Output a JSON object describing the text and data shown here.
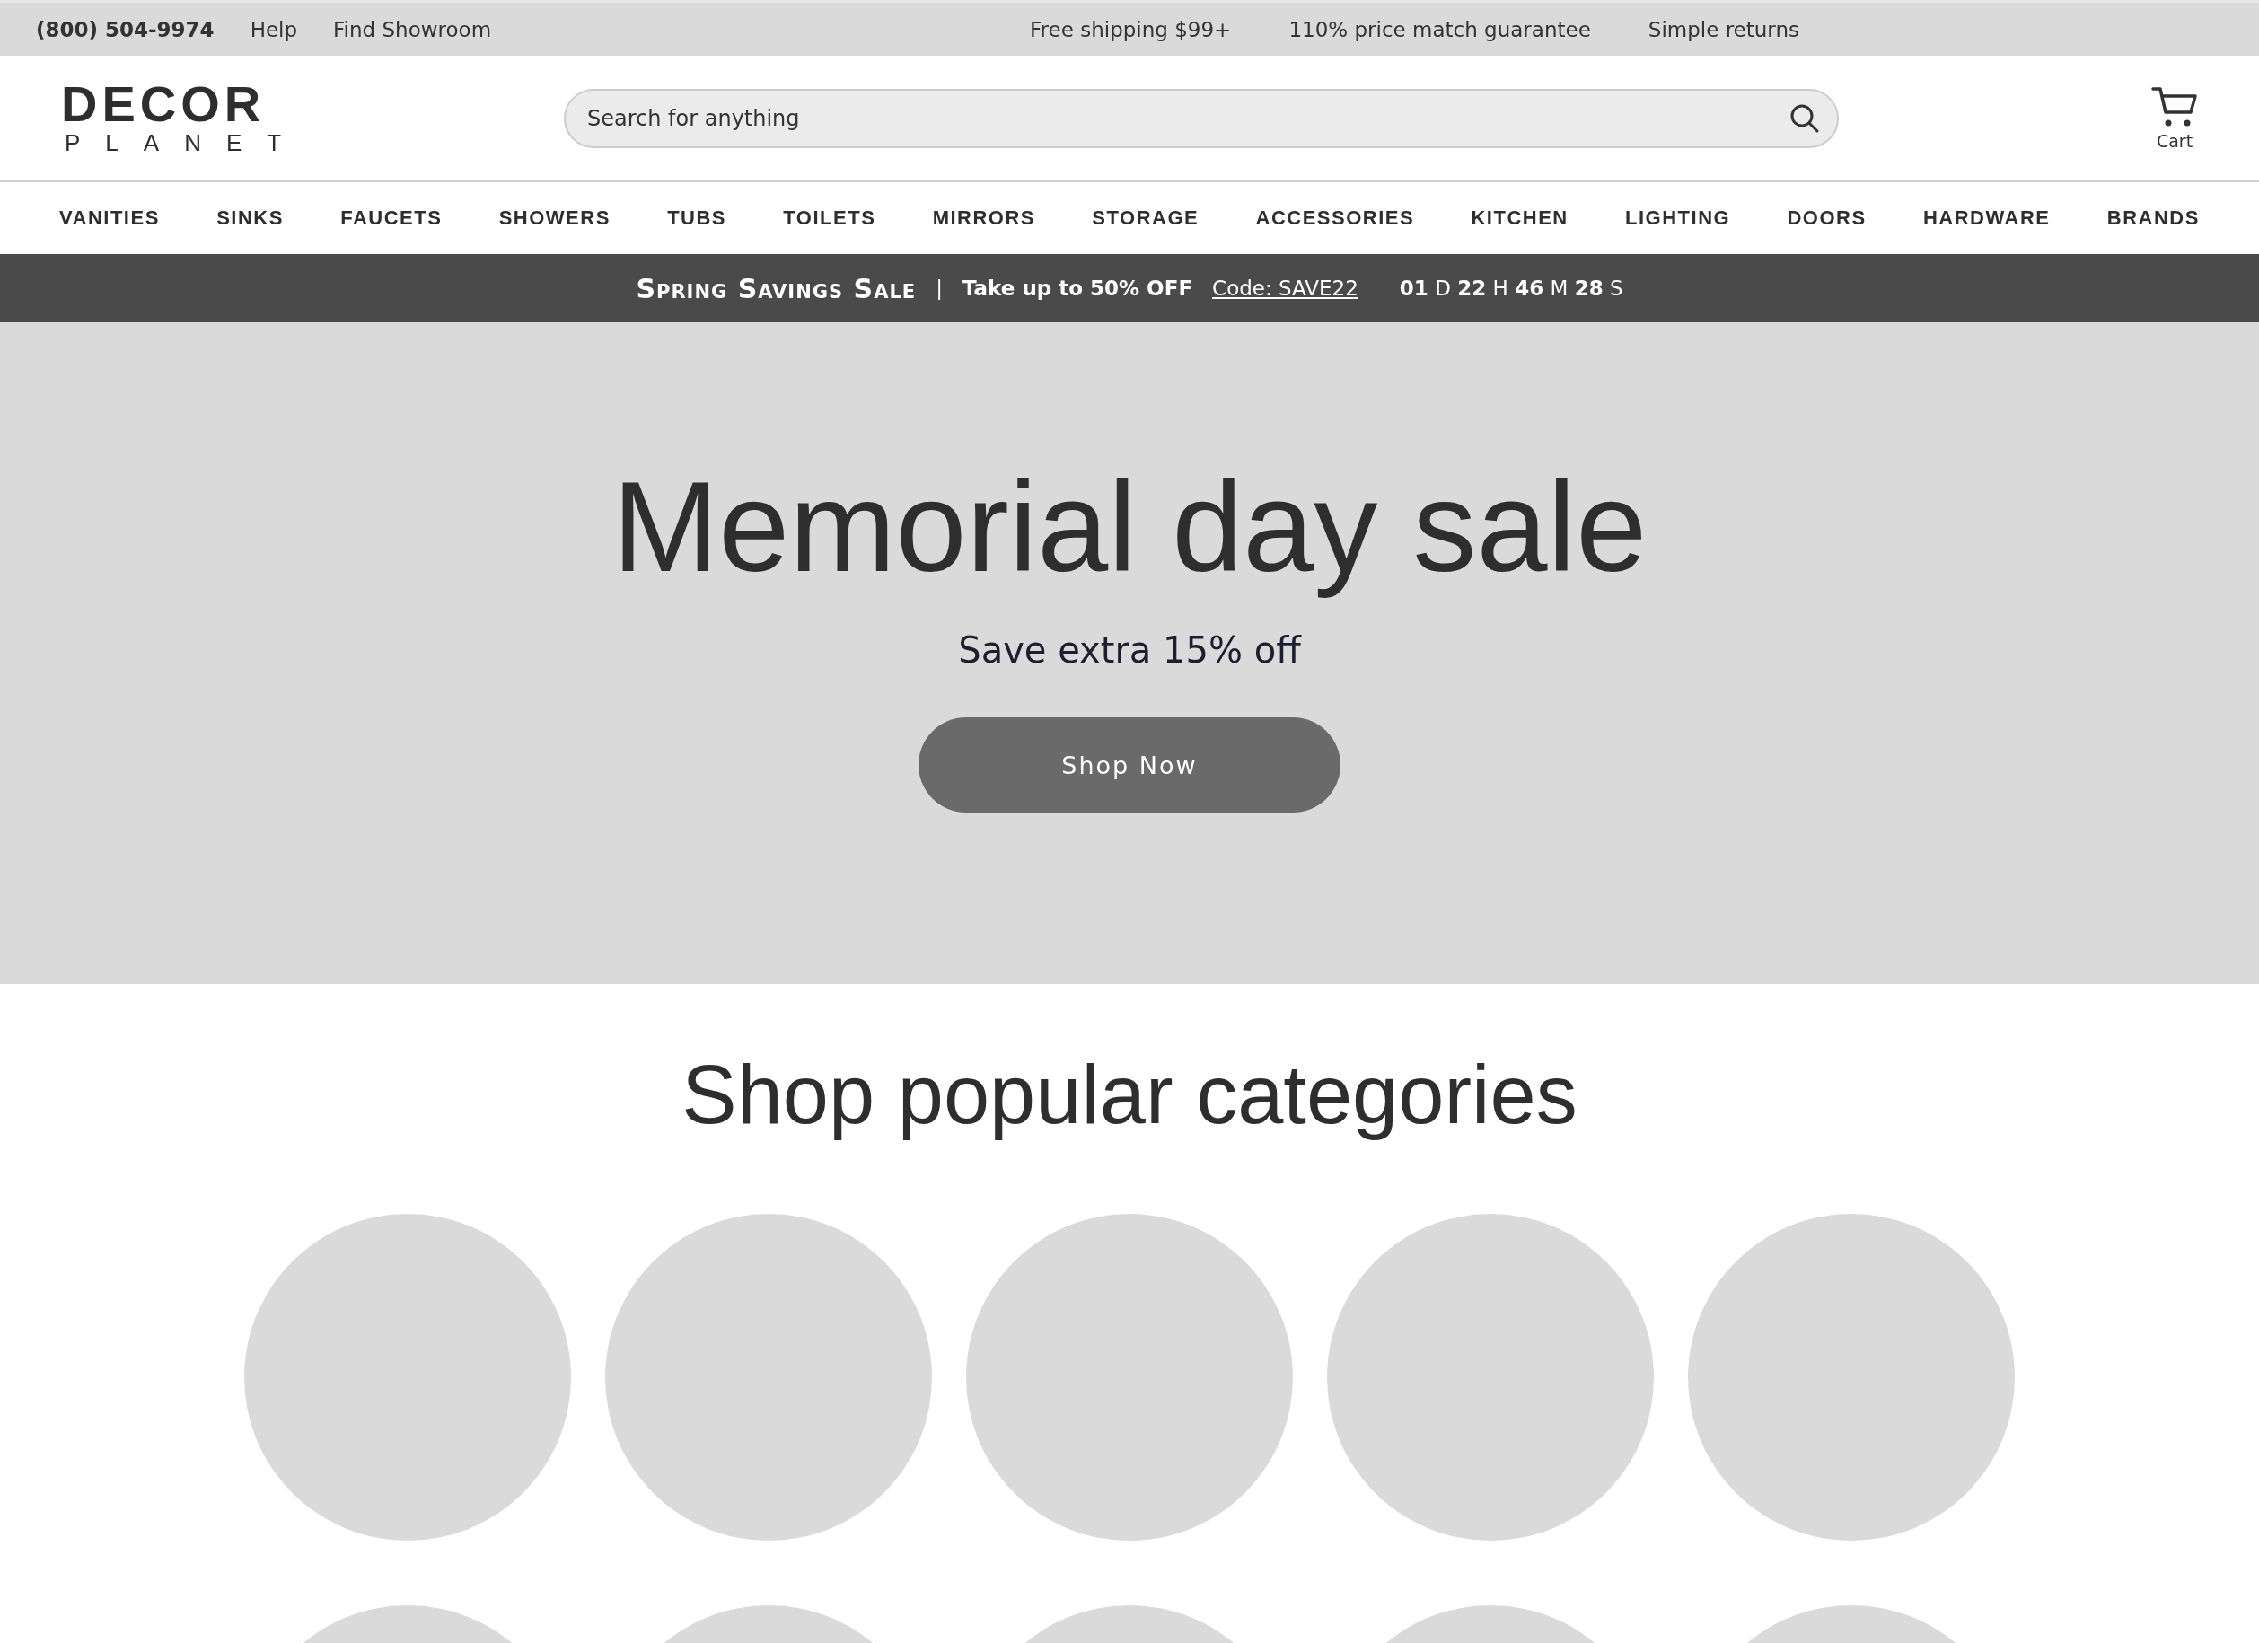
{
  "top_bar": {
    "phone": "(800) 504-9974",
    "links": [
      "Help",
      "Find Showroom"
    ],
    "perks": [
      "Free shipping $99+",
      "110% price match guarantee",
      "Simple returns"
    ]
  },
  "header": {
    "logo": {
      "word": "DECOR",
      "sub": "PLANET"
    },
    "search": {
      "placeholder": "Search for anything"
    },
    "cart": {
      "label": "Cart"
    }
  },
  "nav": {
    "items": [
      "VANITIES",
      "SINKS",
      "FAUCETS",
      "SHOWERS",
      "TUBS",
      "TOILETS",
      "MIRRORS",
      "STORAGE",
      "ACCESSORIES",
      "KITCHEN",
      "LIGHTING",
      "DOORS",
      "HARDWARE",
      "BRANDS"
    ]
  },
  "promo": {
    "title": "Spring Savings Sale",
    "separator": "|",
    "offer": "Take up to 50% OFF",
    "code": "Code: SAVE22",
    "countdown": "**01** D **22** H **46** M **28** S"
  },
  "hero": {
    "title": "Memorial day sale",
    "subtitle": "Save extra 15% off",
    "button": "Shop Now"
  },
  "categories": {
    "title": "Shop popular categories",
    "items": [
      {
        "kind": "placeholder"
      },
      {
        "kind": "placeholder"
      },
      {
        "kind": "placeholder"
      },
      {
        "kind": "placeholder"
      },
      {
        "kind": "placeholder"
      },
      {
        "kind": "placeholder"
      },
      {
        "kind": "placeholder"
      },
      {
        "kind": "placeholder"
      },
      {
        "kind": "placeholder"
      },
      {
        "kind": "placeholder"
      }
    ]
  }
}
